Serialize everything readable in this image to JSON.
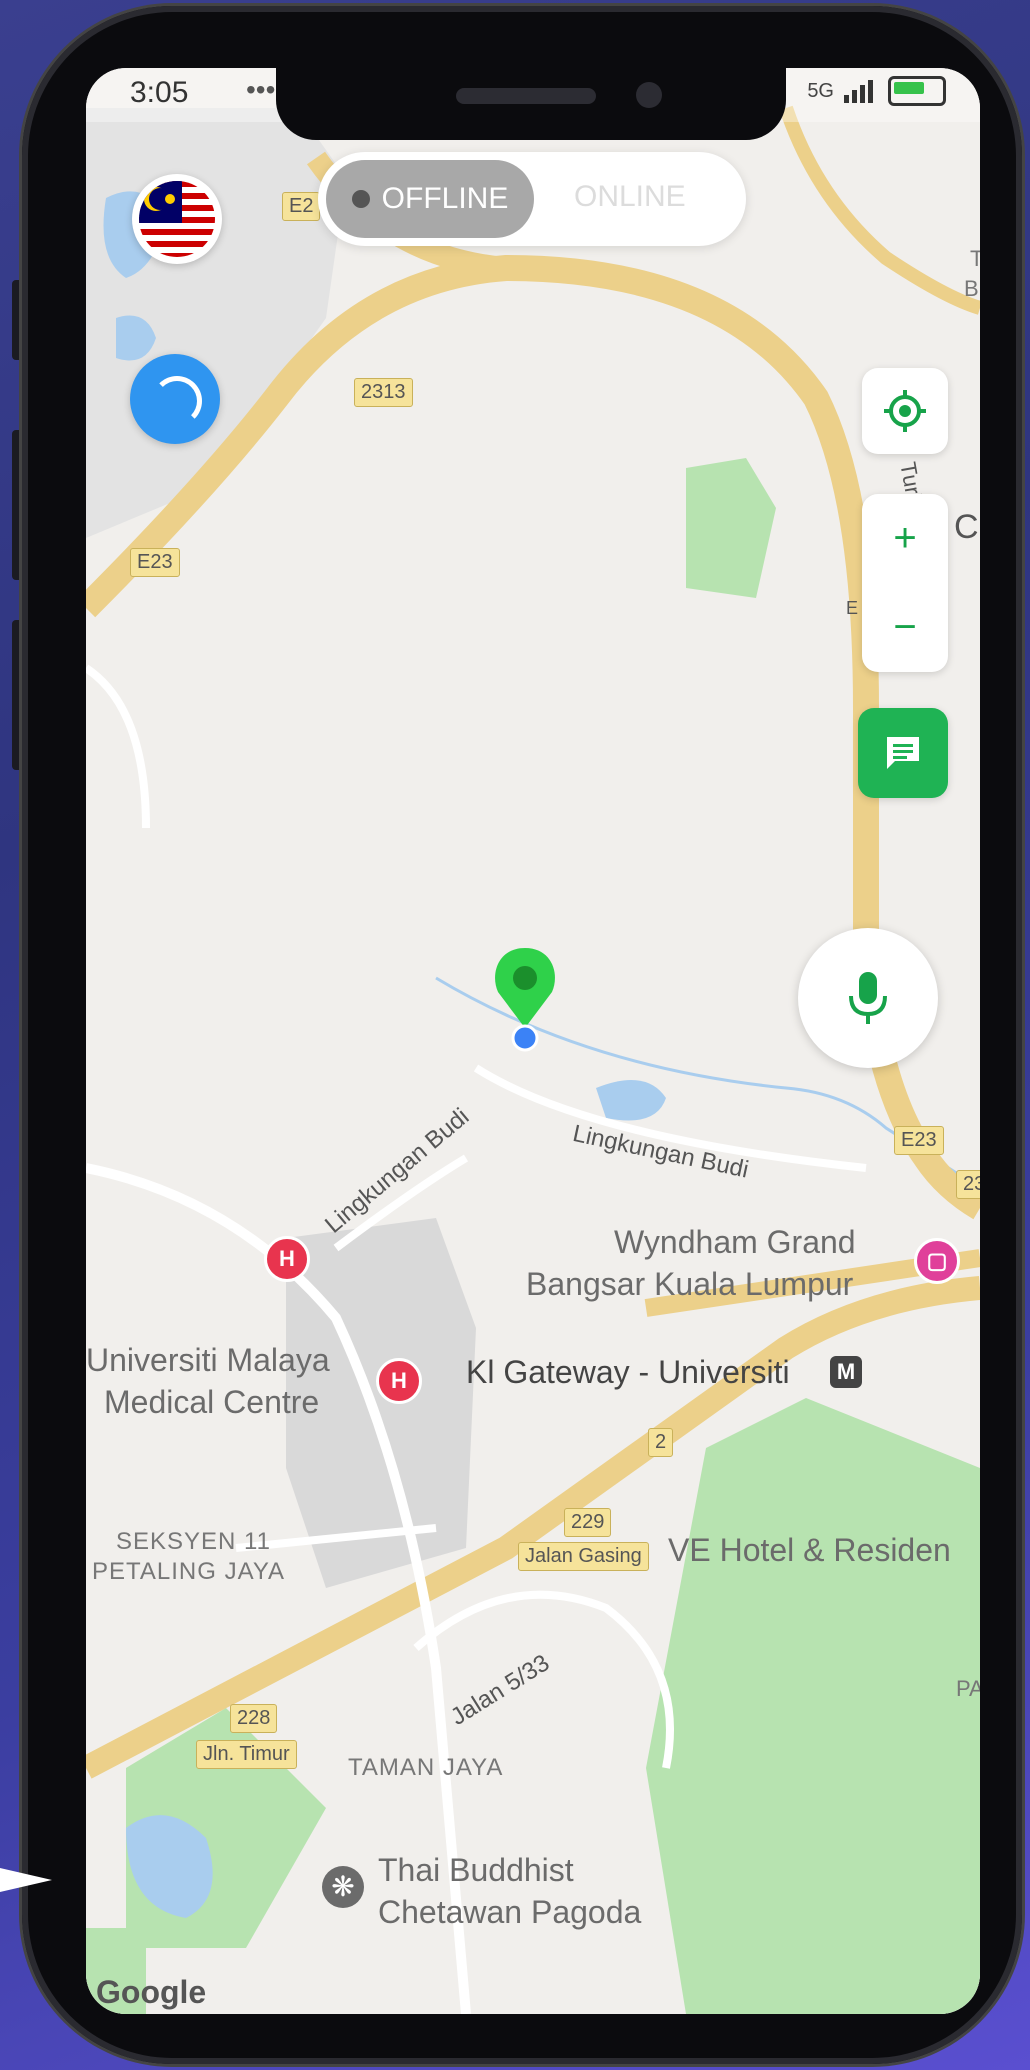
{
  "status_bar": {
    "time": "3:05",
    "dots": "•••",
    "network": "5G"
  },
  "toggle": {
    "offline_label": "OFFLINE",
    "online_label": "ONLINE",
    "state": "offline"
  },
  "controls": {
    "flag_icon": "malaysia-flag",
    "loading_icon": "loading-spinner",
    "locate_icon": "crosshair-icon",
    "zoom_in": "+",
    "zoom_out": "−",
    "chat_icon": "chat-icon",
    "mic_icon": "microphone-icon"
  },
  "map": {
    "road_shields": [
      "E2",
      "2313",
      "E23",
      "E23",
      "23",
      "2",
      "229",
      "228"
    ],
    "labels": {
      "e2": "E2",
      "r2313": "2313",
      "e23_left": "E23",
      "e23_right": "E23",
      "r23": "23",
      "r2": "2",
      "r229": "229",
      "r228": "228",
      "lingkungan_budi_1": "Lingkungan Budi",
      "lingkungan_budi_2": "Lingkungan Budi",
      "wyndham_1": "Wyndham Grand",
      "wyndham_2": "Bangsar Kuala Lumpur",
      "um_medical_1": "Universiti Malaya",
      "um_medical_2": "Medical Centre",
      "kl_gateway": "Kl Gateway - Universiti",
      "metro_badge": "M",
      "jalan_gasing": "Jalan Gasing",
      "ve_hotel": "VE Hotel & Residen",
      "seksyen_11": "SEKSYEN 11",
      "petaling_jaya": "PETALING JAYA",
      "jalan_533": "Jalan 5/33",
      "jln_timur": "Jln. Timur",
      "taman_jaya": "TAMAN JAYA",
      "thai_buddhist_1": "Thai Buddhist",
      "thai_buddhist_2": "Chetawan Pagoda",
      "google": "Google",
      "edge_c": "C",
      "edge_t": "T",
      "edge_b": "B",
      "edge_pa": "PA",
      "edge_turi": "Turi",
      "edge_e": "E"
    },
    "hospital_marker": "H",
    "colors": {
      "road": "#ecd08a",
      "park": "#b7e3b0",
      "water": "#a9cdee",
      "built": "#d6d6d6",
      "brand_green": "#1fb354",
      "pin_green": "#2fd14a",
      "user_dot": "#3b82f6"
    }
  }
}
